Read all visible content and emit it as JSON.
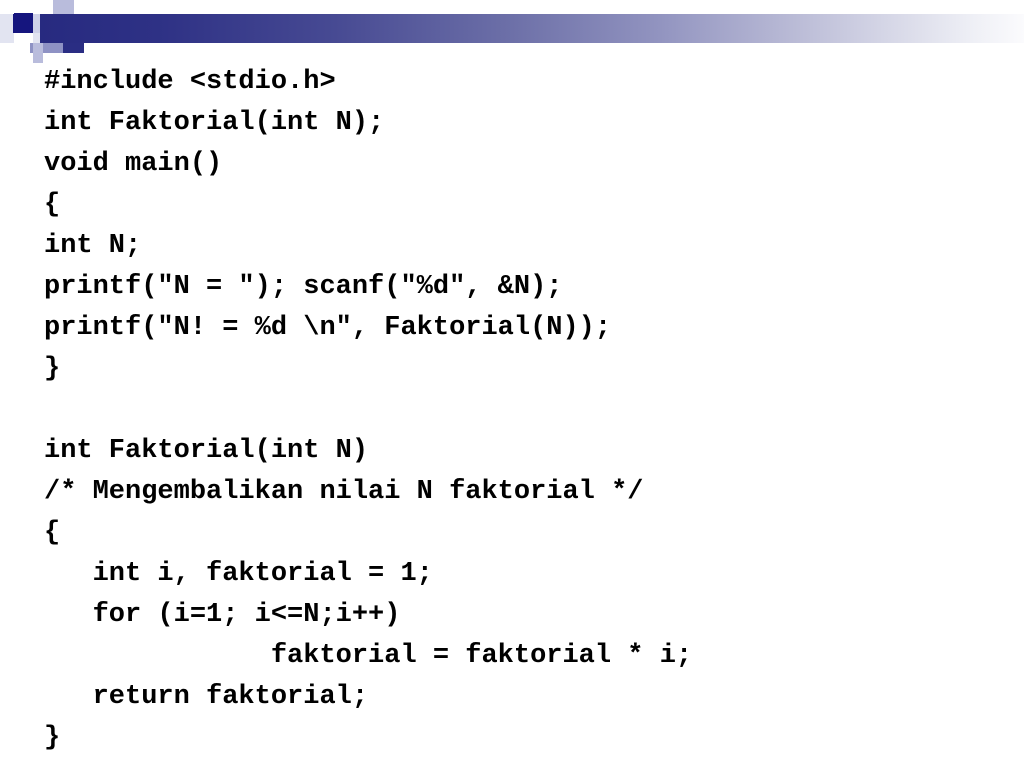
{
  "slide": {
    "background_color": "#ffffff",
    "text_color": "#000000"
  },
  "header": {
    "name": "decorative-header-bar",
    "gradient_from": "#272a80",
    "gradient_to": "#fbfbfd",
    "accent_navy": "#15157e",
    "accent_mid": "#8e92c4",
    "accent_light": "#b9bcdc",
    "accent_pale": "#ced1e8"
  },
  "code": {
    "language": "C",
    "lines": [
      "#include <stdio.h>",
      "int Faktorial(int N);",
      "void main()",
      "{",
      "int N;",
      "printf(\"N = \"); scanf(\"%d\", &N);",
      "printf(\"N! = %d \\n\", Faktorial(N));",
      "}",
      "",
      "int Faktorial(int N)",
      "/* Mengembalikan nilai N faktorial */",
      "{",
      "   int i, faktorial = 1;",
      "   for (i=1; i<=N;i++)",
      "              faktorial = faktorial * i;",
      "   return faktorial;",
      "}"
    ]
  }
}
